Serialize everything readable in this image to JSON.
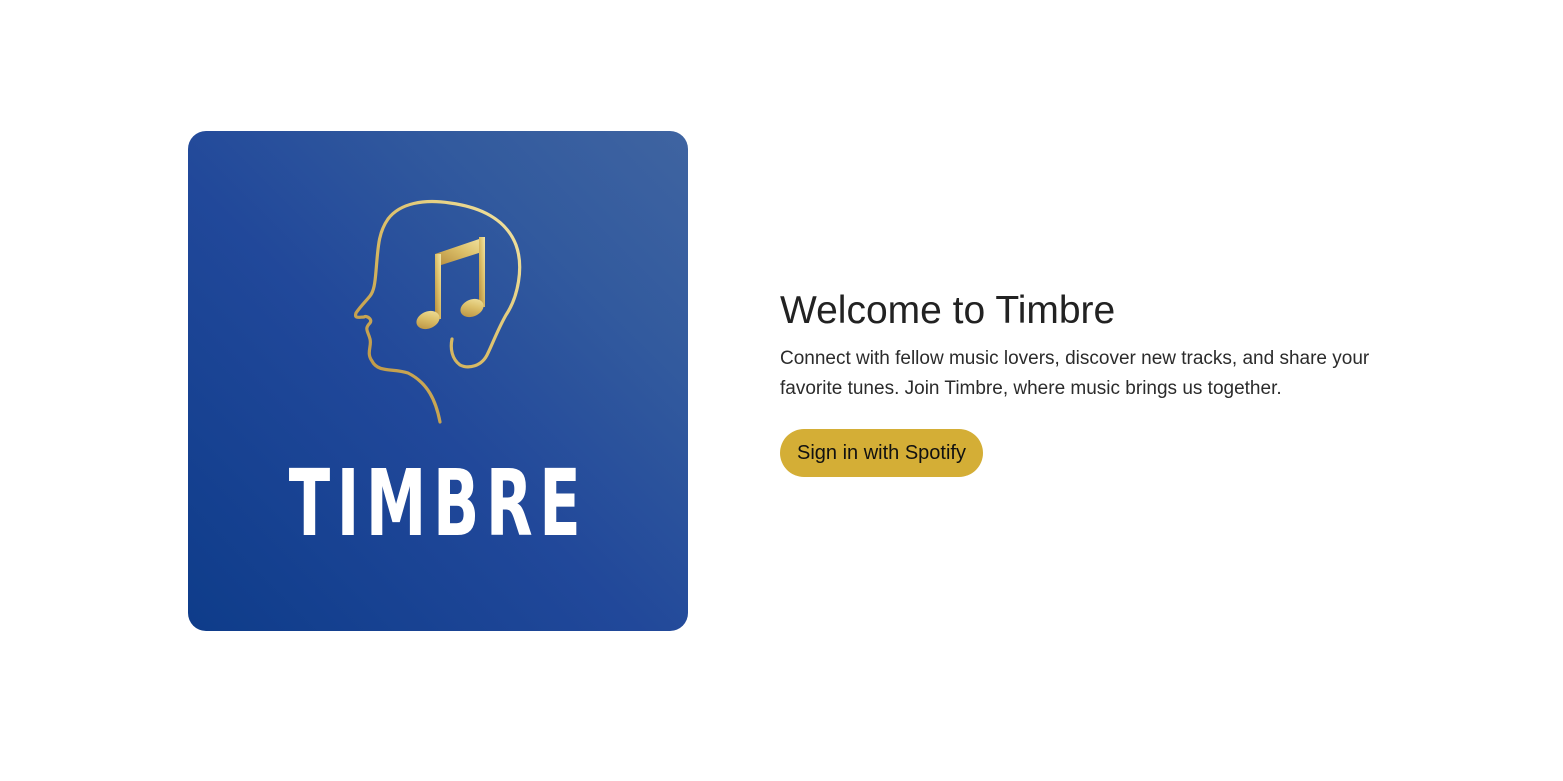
{
  "logo": {
    "wordmark": "TIMBRE",
    "icon": "head-music-note-icon",
    "background_colors": [
      "#0e3c8a",
      "#3f64a1"
    ],
    "accent_color": "#d8b85c"
  },
  "hero": {
    "title": "Welcome to Timbre",
    "description": "Connect with fellow music lovers, discover new tracks, and share your favorite tunes. Join Timbre, where music brings us together.",
    "signin_label": "Sign in with Spotify"
  },
  "colors": {
    "button": "#d4ae36",
    "title_text": "#222222"
  }
}
